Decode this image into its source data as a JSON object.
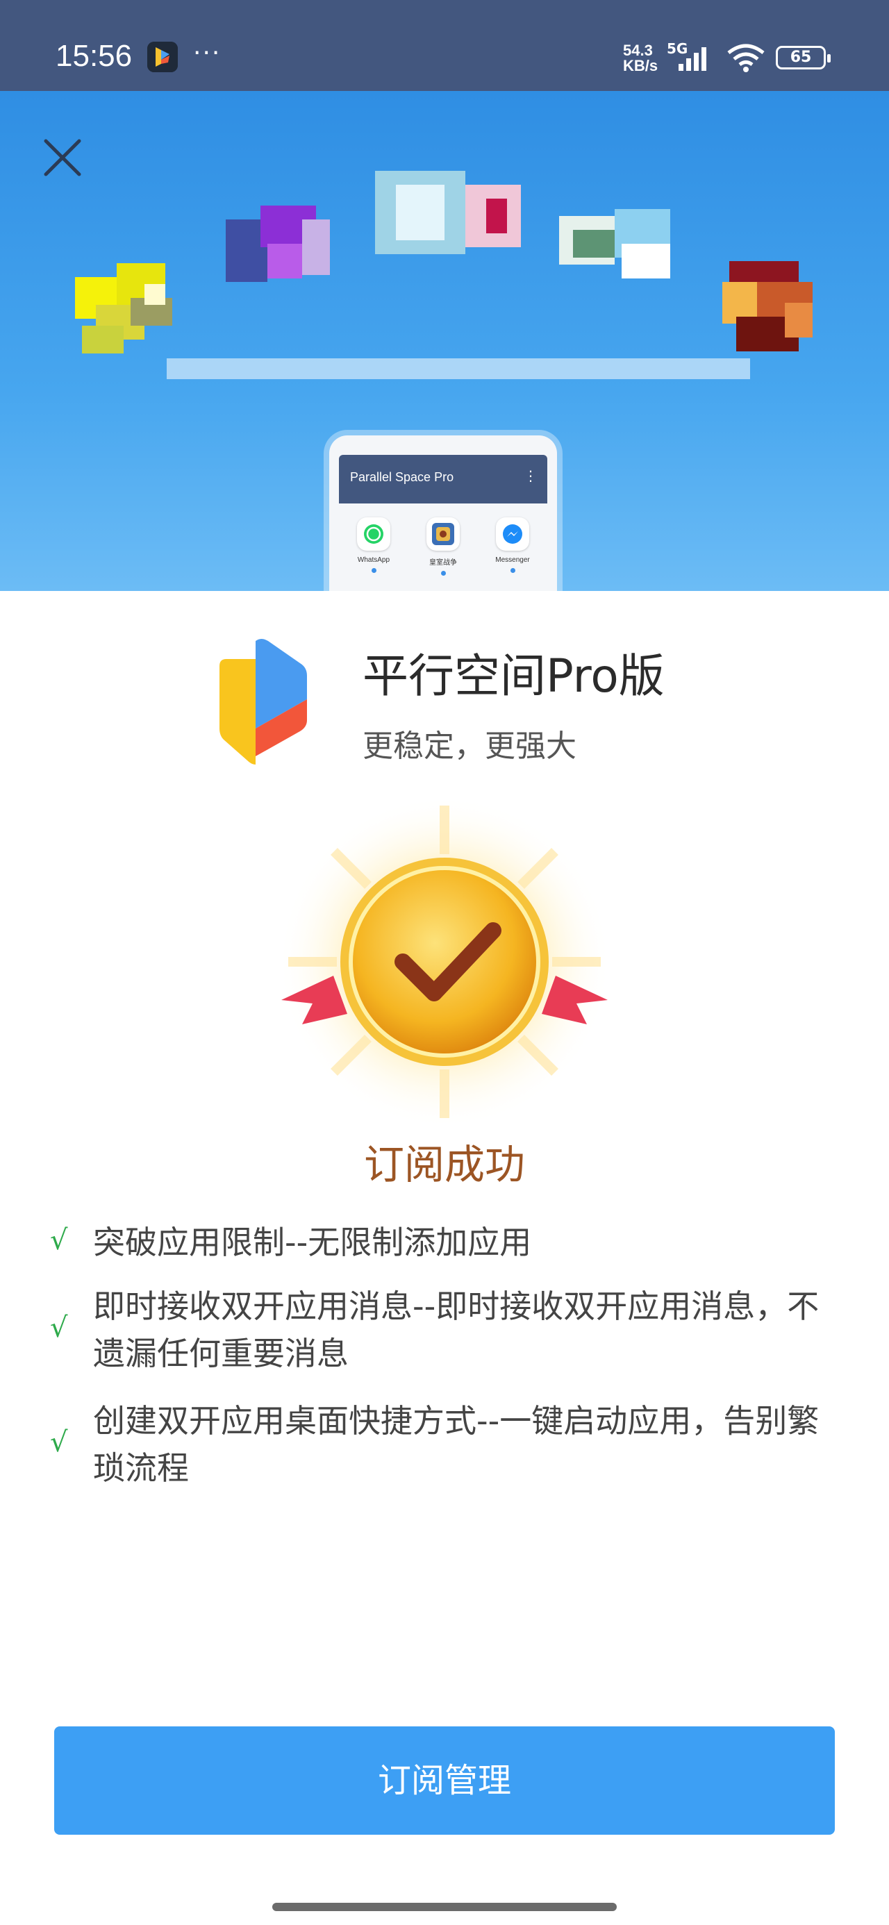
{
  "status_bar": {
    "time": "15:56",
    "more": "···",
    "speed_value": "54.3",
    "speed_unit": "KB/s",
    "network": "5G",
    "battery": "65"
  },
  "banner": {
    "phone_title": "Parallel Space Pro",
    "phone_menu": "⋮",
    "apps": [
      {
        "label": "WhatsApp"
      },
      {
        "label": "皇室战争"
      },
      {
        "label": "Messenger"
      }
    ]
  },
  "product": {
    "title": "平行空间Pro版",
    "subtitle": "更稳定，更强大"
  },
  "result": {
    "status": "订阅成功"
  },
  "features": [
    {
      "check": "√",
      "text": "突破应用限制--无限制添加应用"
    },
    {
      "check": "√",
      "text": "即时接收双开应用消息--即时接收双开应用消息，不遗漏任何重要消息"
    },
    {
      "check": "√",
      "text": "创建双开应用桌面快捷方式--一键启动应用，告别繁琐流程"
    }
  ],
  "actions": {
    "manage_label": "订阅管理"
  },
  "colors": {
    "status_bar": "#43577f",
    "banner": "#3d9ff4",
    "success_text": "#9c5524",
    "check": "#2eaa4b",
    "button": "#3d9ff4"
  }
}
